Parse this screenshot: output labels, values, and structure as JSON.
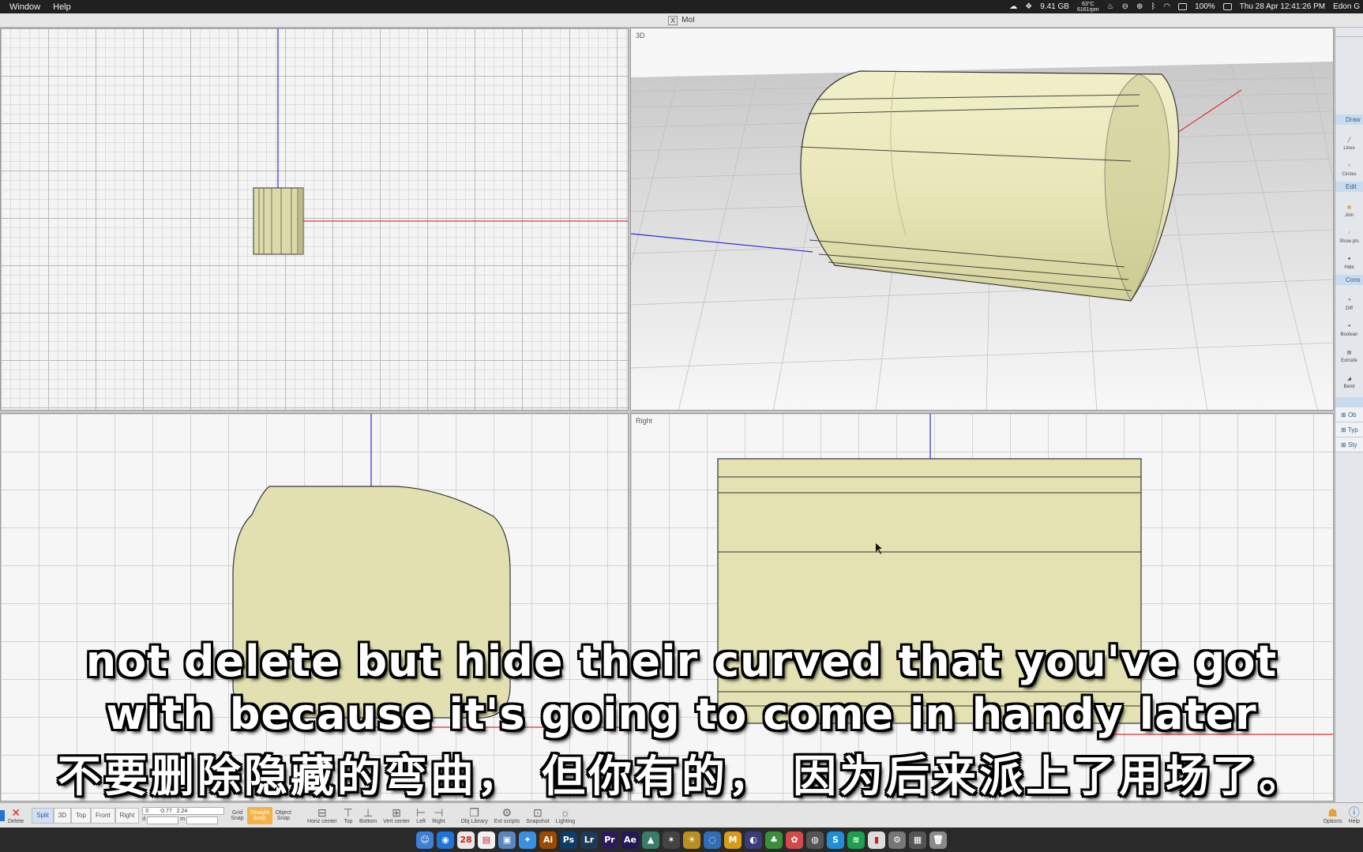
{
  "menubar": {
    "items": [
      "Window",
      "Help"
    ],
    "status": {
      "memory": "9.41 GB",
      "temp": "63°C",
      "rpm": "6161rpm",
      "battery": "100%",
      "datetime": "Thu 28 Apr  12:41:26 PM",
      "user": "Edon G"
    }
  },
  "window": {
    "title": "MoI"
  },
  "viewports": {
    "top_left": {
      "label": ""
    },
    "three_d": {
      "label": "3D"
    },
    "front": {
      "label": ""
    },
    "right": {
      "label": "Right"
    }
  },
  "palette": {
    "draw_header": "Draw",
    "lines": "Lines",
    "circles": "Circles",
    "edit_header": "Edit",
    "join": "Join",
    "show_pts": "Show pts",
    "hide": "Hide",
    "construct_header": "Cons",
    "diff": "Diff",
    "boolean": "Boolean",
    "extrude": "Extrude",
    "bend": "Bend",
    "rows": [
      "Ob",
      "Typ",
      "Sty"
    ]
  },
  "toolbar": {
    "delete": "Delete",
    "views": [
      "Split",
      "3D",
      "Top",
      "Front",
      "Right"
    ],
    "active_view": "Split",
    "grid_snap": "Grid\nSnap",
    "straight_snap": "Straight\nSnap",
    "object_snap": "Object\nSnap",
    "coord_x": "0",
    "coord_y": "-0.77",
    "coord_z": "2.24",
    "coord_d_label": "d",
    "coord_m_label": "m",
    "horiz_center": "Horiz center",
    "top": "Top",
    "bottom": "Bottom",
    "vert_center": "Vert center",
    "left": "Left",
    "right": "Right",
    "obj_library": "Obj Library",
    "ext_scripts": "Ext scripts",
    "snapshot": "Snapshot",
    "lighting": "Lighting",
    "options": "Options",
    "help": "Help"
  },
  "dock": {
    "apps": [
      {
        "name": "finder",
        "glyph": "☺",
        "color": "#3f7fd6"
      },
      {
        "name": "chrome",
        "glyph": "◉",
        "color": "#1f74d8"
      },
      {
        "name": "calendar",
        "glyph": "28",
        "color": "#e9e9e9"
      },
      {
        "name": "notes",
        "glyph": "▤",
        "color": "#f1f1f1"
      },
      {
        "name": "preview",
        "glyph": "▣",
        "color": "#5a86c0"
      },
      {
        "name": "safari",
        "glyph": "✦",
        "color": "#3a8fe0"
      },
      {
        "name": "illustrator",
        "glyph": "Ai",
        "color": "#9c4a00"
      },
      {
        "name": "photoshop",
        "glyph": "Ps",
        "color": "#0e3d66"
      },
      {
        "name": "lightroom",
        "glyph": "Lr",
        "color": "#1c3b57"
      },
      {
        "name": "premiere",
        "glyph": "Pr",
        "color": "#2d1a58"
      },
      {
        "name": "after-effects",
        "glyph": "Ae",
        "color": "#221a55"
      },
      {
        "name": "moi",
        "glyph": "▲",
        "color": "#3a7c6a"
      },
      {
        "name": "app-a",
        "glyph": "✶",
        "color": "#444"
      },
      {
        "name": "app-b",
        "glyph": "☀",
        "color": "#b88f21"
      },
      {
        "name": "app-c",
        "glyph": "◌",
        "color": "#2f6db5"
      },
      {
        "name": "app-m",
        "glyph": "M",
        "color": "#d89a1b"
      },
      {
        "name": "app-d",
        "glyph": "◐",
        "color": "#3c3c7a"
      },
      {
        "name": "app-e",
        "glyph": "♣",
        "color": "#3b8e3a"
      },
      {
        "name": "app-f",
        "glyph": "✿",
        "color": "#d34a4a"
      },
      {
        "name": "app-g",
        "glyph": "◍",
        "color": "#555"
      },
      {
        "name": "skype",
        "glyph": "S",
        "color": "#1f8fd6"
      },
      {
        "name": "spotify",
        "glyph": "≋",
        "color": "#1d9e50"
      },
      {
        "name": "app-h",
        "glyph": "▮",
        "color": "#ddd"
      },
      {
        "name": "app-i",
        "glyph": "⚙",
        "color": "#777"
      },
      {
        "name": "app-j",
        "glyph": "▦",
        "color": "#555"
      },
      {
        "name": "trash",
        "glyph": "🗑",
        "color": "#8a8a8a"
      }
    ]
  },
  "subtitles": {
    "line1": "not delete but hide their curved that you've got",
    "line2": "with because it's going to come in handy later",
    "line3": "不要删除隐藏的弯曲， 但你有的， 因为后来派上了用场了。"
  },
  "colors": {
    "solid": "#e4e2b3",
    "solid_dark": "#cfcd98",
    "axis_x": "#e03030",
    "axis_y": "#3030d0",
    "palette_head": "#c9dbee"
  }
}
